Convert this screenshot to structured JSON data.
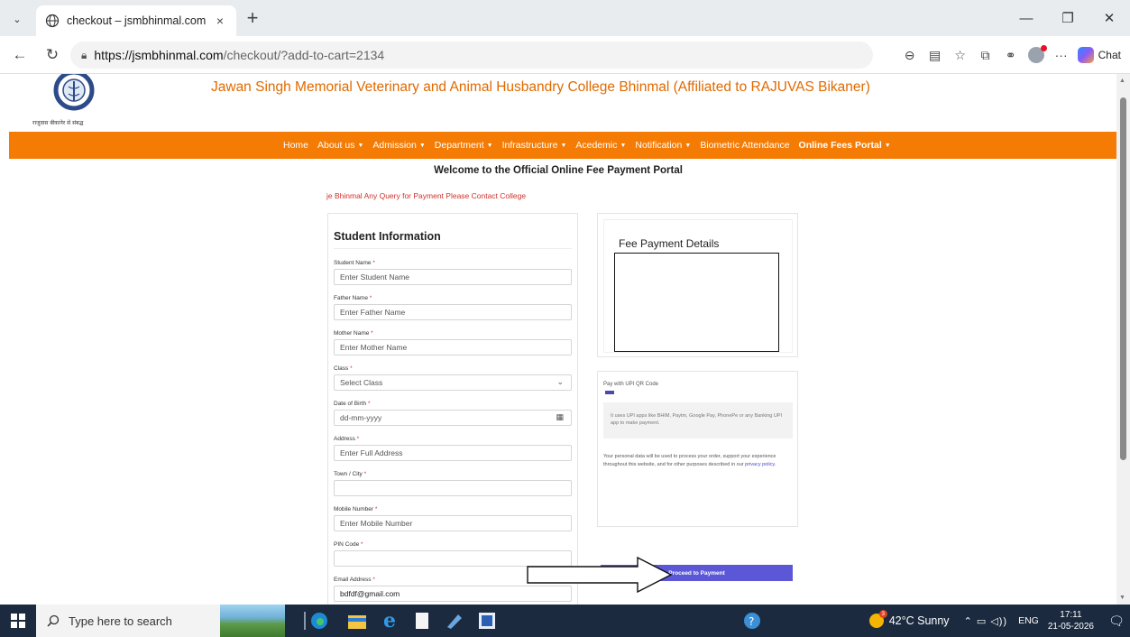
{
  "browser": {
    "tab_title": "checkout – jsmbhinmal.com",
    "tab_close": "×",
    "new_tab": "+",
    "url_host": "https://jsmbhinmal.com",
    "url_path": "/checkout/?add-to-cart=2134",
    "chat_label": "Chat",
    "more": "···"
  },
  "site": {
    "college_title": "Jawan Singh Memorial Veterinary and Animal Husbandry College Bhinmal (Affiliated to RAJUVAS Bikaner)",
    "logo_caption": "राजुवास बीकानेर से संबद्ध",
    "menu": [
      {
        "label": "Home",
        "dropdown": false
      },
      {
        "label": "About us",
        "dropdown": true
      },
      {
        "label": "Admission",
        "dropdown": true
      },
      {
        "label": "Department",
        "dropdown": true
      },
      {
        "label": "Infrastructure",
        "dropdown": true
      },
      {
        "label": "Acedemic",
        "dropdown": true
      },
      {
        "label": "Notification",
        "dropdown": true
      },
      {
        "label": "Biometric Attendance",
        "dropdown": false
      },
      {
        "label": "Online Fees Portal",
        "dropdown": true
      }
    ],
    "welcome": "Welcome to the Official Online Fee Payment Portal",
    "marquee": "je Bhinmal Any Query for Payment Please Contact College"
  },
  "form": {
    "heading": "Student Information",
    "fields": [
      {
        "label": "Student Name",
        "placeholder": "Enter Student Name",
        "value": ""
      },
      {
        "label": "Father Name",
        "placeholder": "Enter Father Name",
        "value": ""
      },
      {
        "label": "Mother Name",
        "placeholder": "Enter Mother Name",
        "value": ""
      },
      {
        "label": "Class",
        "placeholder": "Select Class",
        "value": ""
      },
      {
        "label": "Date of Birth",
        "placeholder": "dd-mm-yyyy",
        "value": ""
      },
      {
        "label": "Address",
        "placeholder": "Enter Full Address",
        "value": ""
      },
      {
        "label": "Town / City",
        "placeholder": "",
        "value": ""
      },
      {
        "label": "Mobile Number",
        "placeholder": "Enter Mobile Number",
        "value": ""
      },
      {
        "label": "PIN Code",
        "placeholder": "",
        "value": ""
      },
      {
        "label": "Email Address",
        "placeholder": "",
        "value": "bdfdf@gmail.com"
      }
    ]
  },
  "fee": {
    "heading": "Fee Payment Details",
    "upi_label": "Pay with UPI QR Code",
    "upi_note": "It uses UPI apps like BHIM, Paytm, Google Pay, PhonePe or any Banking UPI app to make payment.",
    "privacy_text": "Your personal data will be used to process your order, support your experience throughout this website, and for other purposes described in our",
    "privacy_link": "privacy policy.",
    "proceed_label": "Proceed to Payment"
  },
  "taskbar": {
    "search_placeholder": "Type here to search",
    "weather": "42°C  Sunny",
    "lang": "ENG",
    "time": "17:11",
    "date": "21-05-2026"
  },
  "colors": {
    "orange": "#f47b04",
    "button": "#5b57d6",
    "required": "#d0312d"
  }
}
